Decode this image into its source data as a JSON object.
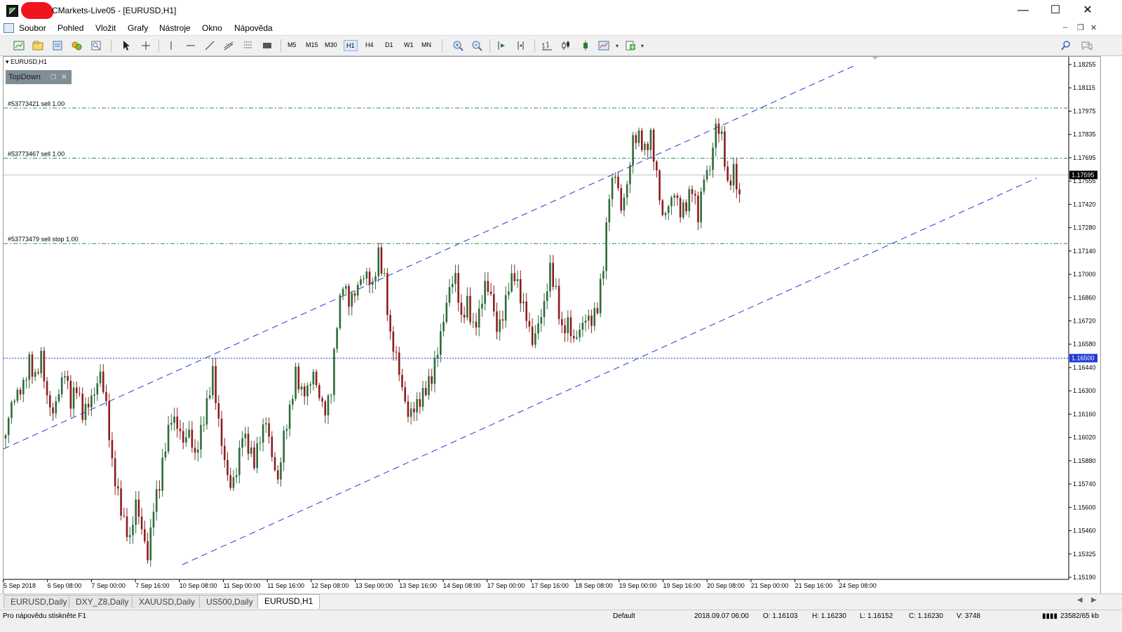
{
  "window": {
    "title": "CMarkets-Live05 - [EURUSD,H1]",
    "min": "—",
    "max": "☐",
    "close": "✕"
  },
  "menu": [
    "Soubor",
    "Pohled",
    "Vložit",
    "Grafy",
    "Nástroje",
    "Okno",
    "Nápověda"
  ],
  "toolbar": {
    "timeframes": [
      "M5",
      "M15",
      "M30",
      "H1",
      "H4",
      "D1",
      "W1",
      "MN"
    ],
    "active_timeframe": "H1"
  },
  "chart": {
    "title": "EURUSD,H1",
    "indicator_label": "TopDown",
    "current_price": "1.17595",
    "level_price": "1.16500",
    "colors": {
      "bull": "#2e6b3a",
      "bear": "#8c1d1d",
      "order": "#2e8b57",
      "channel": "#1f3bd6",
      "level": "#1f3bd6"
    }
  },
  "chart_data": {
    "type": "candlestick",
    "title": "EURUSD,H1",
    "ylim": [
      1.1519,
      1.18255
    ],
    "price_ticks": [
      "1.18255",
      "1.18115",
      "1.17975",
      "1.17835",
      "1.17695",
      "1.17555",
      "1.17420",
      "1.17280",
      "1.17140",
      "1.17000",
      "1.16860",
      "1.16720",
      "1.16580",
      "1.16440",
      "1.16300",
      "1.16160",
      "1.16020",
      "1.15880",
      "1.15740",
      "1.15600",
      "1.15460",
      "1.15325",
      "1.15190"
    ],
    "x_ticks": [
      "5 Sep 2018",
      "6 Sep 08:00",
      "7 Sep 00:00",
      "7 Sep 16:00",
      "10 Sep 08:00",
      "11 Sep 00:00",
      "11 Sep 16:00",
      "12 Sep 08:00",
      "13 Sep 00:00",
      "13 Sep 16:00",
      "14 Sep 08:00",
      "17 Sep 00:00",
      "17 Sep 16:00",
      "18 Sep 08:00",
      "19 Sep 00:00",
      "19 Sep 16:00",
      "20 Sep 08:00",
      "21 Sep 00:00",
      "21 Sep 16:00",
      "24 Sep 08:00"
    ],
    "orders": [
      {
        "label": "#53773421 sell 1.00",
        "price": 1.17995
      },
      {
        "label": "#53773467 sell 1.00",
        "price": 1.17695
      },
      {
        "label": "#53773479 sell stop 1.00",
        "price": 1.17185
      }
    ],
    "horizontal_level": {
      "price": 1.165,
      "label": "1.16500"
    },
    "bid_line": {
      "price": 1.17595,
      "label": "1.17595"
    },
    "series": [
      {
        "name": "EURUSD",
        "path": [
          1.1604,
          1.1622,
          1.1628,
          1.1633,
          1.1648,
          1.1638,
          1.1652,
          1.1627,
          1.1618,
          1.1631,
          1.1643,
          1.1624,
          1.1633,
          1.1616,
          1.1622,
          1.1628,
          1.164,
          1.1621,
          1.1586,
          1.1568,
          1.1552,
          1.1542,
          1.1565,
          1.1549,
          1.1532,
          1.1562,
          1.1575,
          1.1598,
          1.1614,
          1.1609,
          1.1599,
          1.1605,
          1.159,
          1.1606,
          1.1622,
          1.1642,
          1.1612,
          1.1589,
          1.1574,
          1.1583,
          1.1606,
          1.1597,
          1.1588,
          1.1602,
          1.1612,
          1.159,
          1.1575,
          1.1603,
          1.1618,
          1.1641,
          1.163,
          1.1632,
          1.1642,
          1.1628,
          1.1619,
          1.1632,
          1.1672,
          1.1695,
          1.1683,
          1.1688,
          1.1696,
          1.1699,
          1.1692,
          1.1712,
          1.1697,
          1.1663,
          1.1652,
          1.1633,
          1.1617,
          1.1621,
          1.1625,
          1.1632,
          1.1638,
          1.1654,
          1.1672,
          1.1691,
          1.1698,
          1.1672,
          1.1683,
          1.1668,
          1.1677,
          1.1695,
          1.1689,
          1.1668,
          1.1676,
          1.1694,
          1.17,
          1.1686,
          1.1674,
          1.1658,
          1.1669,
          1.1681,
          1.1703,
          1.1689,
          1.1666,
          1.1672,
          1.1661,
          1.1668,
          1.1675,
          1.1673,
          1.1681,
          1.1706,
          1.1748,
          1.176,
          1.1738,
          1.1752,
          1.178,
          1.1782,
          1.1774,
          1.1783,
          1.176,
          1.1735,
          1.1742,
          1.175,
          1.1738,
          1.1742,
          1.1752,
          1.1734,
          1.1758,
          1.1762,
          1.1788,
          1.1782,
          1.1752,
          1.1762,
          1.1748
        ]
      }
    ]
  },
  "tabs": [
    "EURUSD,Daily",
    "DXY_Z8,Daily",
    "XAUUSD,Daily",
    "US500,Daily",
    "EURUSD,H1"
  ],
  "active_tab": "EURUSD,H1",
  "status": {
    "help": "Pro nápovědu stiskněte F1",
    "profile": "Default",
    "datetime": "2018.09.07 06:00",
    "open": "O: 1.16103",
    "high": "H: 1.16230",
    "low": "L: 1.16152",
    "close": "C: 1.16230",
    "volume": "V: 3748",
    "traffic": "23582/65 kb"
  }
}
